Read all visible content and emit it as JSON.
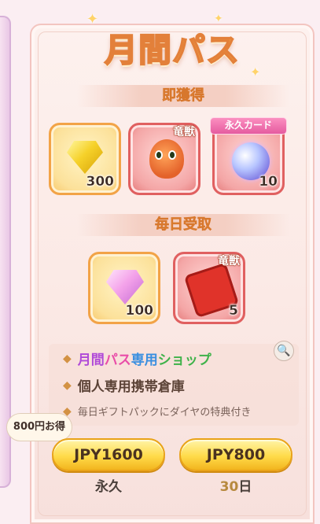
{
  "title": "月間パス",
  "sections": {
    "instant": "即獲得",
    "daily": "毎日受取"
  },
  "instant_items": [
    {
      "icon": "yellow-diamond-icon",
      "count": "300"
    },
    {
      "icon": "orange-dragon-icon",
      "tag": "竜獣"
    },
    {
      "icon": "crystal-orb-icon",
      "ribbon": "永久カード",
      "count": "10"
    }
  ],
  "daily_items": [
    {
      "icon": "pink-diamond-icon",
      "count": "100"
    },
    {
      "icon": "dragon-puzzle-icon",
      "tag": "竜獣",
      "count": "5"
    }
  ],
  "features": {
    "shop": [
      "月間",
      "パス",
      "専用",
      "ショップ"
    ],
    "storage": "個人専用携帯倉庫",
    "gift": "毎日ギフトパックにダイヤの特典付き"
  },
  "promo": "800円お得",
  "buttons": [
    {
      "price": "JPY1600",
      "duration": "永久"
    },
    {
      "price": "JPY800",
      "duration_num": "30",
      "duration_unit": "日"
    }
  ],
  "colors": {
    "title": "#f6b23f",
    "section_text": "#f39b3f",
    "shop_colors": [
      "#b04ad8",
      "#e94da8",
      "#3a8fe0",
      "#3fb24a"
    ]
  }
}
